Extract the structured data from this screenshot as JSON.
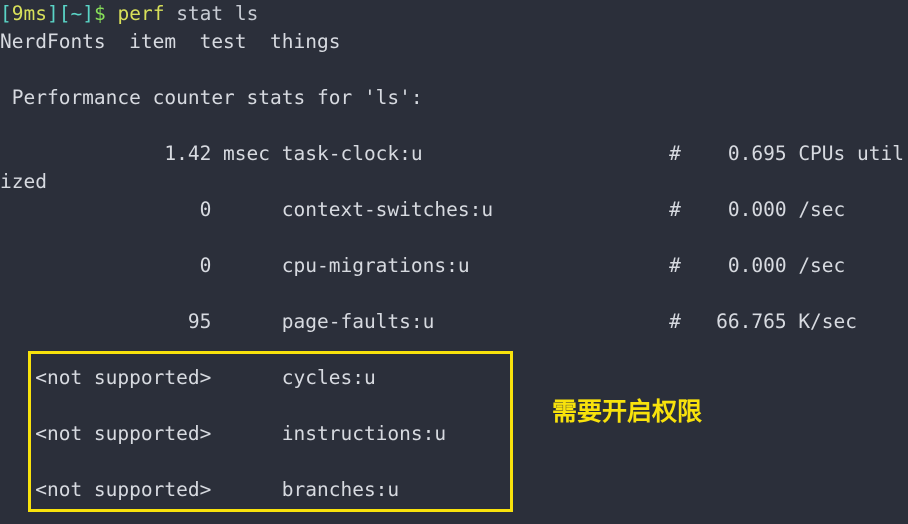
{
  "terminal": {
    "background_color": "#2b2f3a",
    "foreground_color": "#d7dae0",
    "prompt": {
      "open_bracket_1": "[",
      "duration": "9ms",
      "close_bracket_1": "]",
      "open_bracket_2": "[",
      "cwd": "~",
      "close_bracket_2": "]",
      "symbol": "$",
      "command": "perf",
      "command_args": " stat ls",
      "colors": {
        "bracket": "#5ad4c6",
        "duration": "#d8e05a",
        "cwd": "#5ad4c6",
        "symbol": "#88e05a",
        "command": "#d8e05a",
        "args": "#c8ccd4"
      }
    },
    "ls_output": "NerdFonts  item  test  things",
    "stats_header": " Performance counter stats for 'ls':",
    "stat_rows": [
      {
        "value": "              1.42 msec",
        "event": "task-clock:u",
        "hash": "#",
        "metric": "    0.695 CPUs util",
        "wrapped_continuation": "ized"
      },
      {
        "value": "                 0     ",
        "event": "context-switches:u",
        "hash": "#",
        "metric": "    0.000 /sec",
        "wrapped_continuation": ""
      },
      {
        "value": "                 0     ",
        "event": "cpu-migrations:u",
        "hash": "#",
        "metric": "    0.000 /sec",
        "wrapped_continuation": ""
      },
      {
        "value": "                95     ",
        "event": "page-faults:u",
        "hash": "#",
        "metric": "   66.765 K/sec",
        "wrapped_continuation": ""
      },
      {
        "value": "   <not supported>     ",
        "event": "cycles:u",
        "hash": "",
        "metric": "",
        "wrapped_continuation": ""
      },
      {
        "value": "   <not supported>     ",
        "event": "instructions:u",
        "hash": "",
        "metric": "",
        "wrapped_continuation": ""
      },
      {
        "value": "   <not supported>     ",
        "event": "branches:u",
        "hash": "",
        "metric": "",
        "wrapped_continuation": ""
      }
    ],
    "raw_lines": {
      "line_ls": "NerdFonts  item  test  things",
      "line_blank_1": "",
      "line_header": " Performance counter stats for 'ls':",
      "line_blank_2": "",
      "line_taskclock": "              1.42 msec task-clock:u                     #    0.695 CPUs util",
      "line_taskclock_wrap": "ized",
      "line_ctxsw": "                 0      context-switches:u               #    0.000 /sec",
      "line_blank_3": "",
      "line_cpumig": "                 0      cpu-migrations:u                 #    0.000 /sec",
      "line_blank_4": "",
      "line_pagefaults": "                95      page-faults:u                    #   66.765 K/sec",
      "line_blank_5": "",
      "line_cycles": "   <not supported>      cycles:u",
      "line_blank_6": "",
      "line_instructions": "   <not supported>      instructions:u",
      "line_blank_7": "",
      "line_branches": "   <not supported>      branches:u"
    }
  },
  "annotation": {
    "text": "需要开启权限",
    "color": "#f8e20c"
  },
  "highlight_box": {
    "color": "#f8e20c",
    "border_width": "3px"
  }
}
